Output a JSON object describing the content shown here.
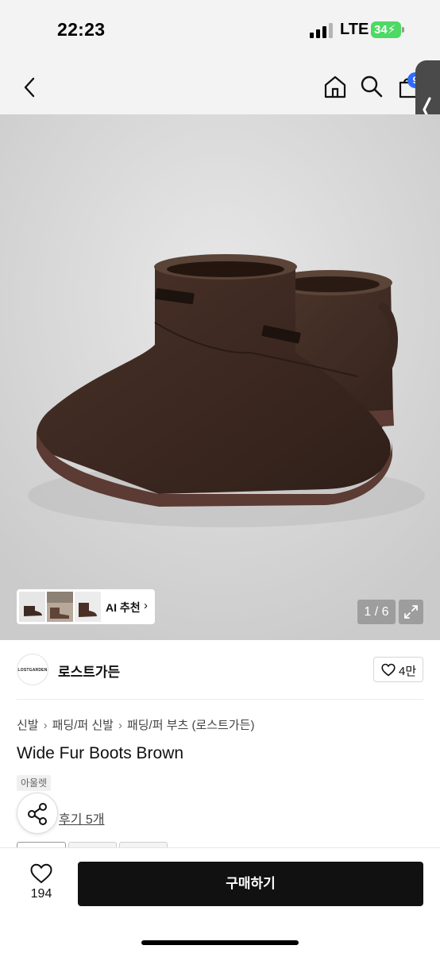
{
  "status_bar": {
    "time": "22:23",
    "network": "LTE",
    "battery": "34"
  },
  "nav": {
    "cart_badge": "9"
  },
  "gallery": {
    "ai_label": "AI 추천",
    "ai_chevron": "›",
    "page_counter": "1 / 6"
  },
  "seller": {
    "logo_text": "LOSTGARDEN",
    "name": "로스트가든",
    "likes": "4만"
  },
  "breadcrumb": [
    "신발",
    "패딩/퍼 신발",
    "패딩/퍼 부츠 (로스트가든)"
  ],
  "breadcrumb_sep": "›",
  "product": {
    "name": "Wide Fur Boots Brown",
    "tag": "아울렛",
    "reviews": "후기 5개"
  },
  "bottom": {
    "wish_count": "194",
    "buy_label": "구매하기"
  },
  "colors": {
    "boot_brown": "#3e2a22",
    "sole_brown": "#5b3b33",
    "badge_blue": "#2f6bff",
    "battery_green": "#4cd964",
    "buy_button": "#111111"
  }
}
